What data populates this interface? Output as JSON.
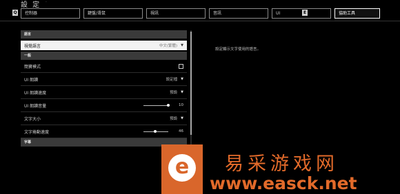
{
  "header": {
    "title": "設 定",
    "subtitle": "·"
  },
  "nav": {
    "prev_key": "Q",
    "next_key": "E"
  },
  "tabs": [
    {
      "label": "控制器"
    },
    {
      "label": "鍵盤/滑鼠"
    },
    {
      "label": "視訊"
    },
    {
      "label": "音訊"
    },
    {
      "label": "UI"
    },
    {
      "label": "協助工具"
    }
  ],
  "sections": {
    "language": "語言",
    "general": "一般",
    "subtitles": "字幕"
  },
  "rows": {
    "language": {
      "label": "視覺語言",
      "value": "中文(繁體)"
    },
    "high_contrast": {
      "label": "簡寶模式"
    },
    "ui_narration": {
      "label": "UI 朗讀",
      "value": "設定檔"
    },
    "narration_speed": {
      "label": "UI 朗讀速度",
      "value": "預設"
    },
    "narration_volume": {
      "label": "UI 朗讀音量",
      "value": "10",
      "level": 1.0
    },
    "text_size": {
      "label": "文字大小",
      "value": "預設"
    },
    "text_scroll_speed": {
      "label": "文字捲動速度",
      "value": "46",
      "level": 0.46
    }
  },
  "description": "設定顯示文字使用的語言。",
  "watermark": {
    "cn": "易采游戏网",
    "url": "www.easck.net",
    "logo_letter": "e"
  },
  "colors": {
    "accent": "#e26a2a",
    "logo_bg": "#d9662b"
  }
}
